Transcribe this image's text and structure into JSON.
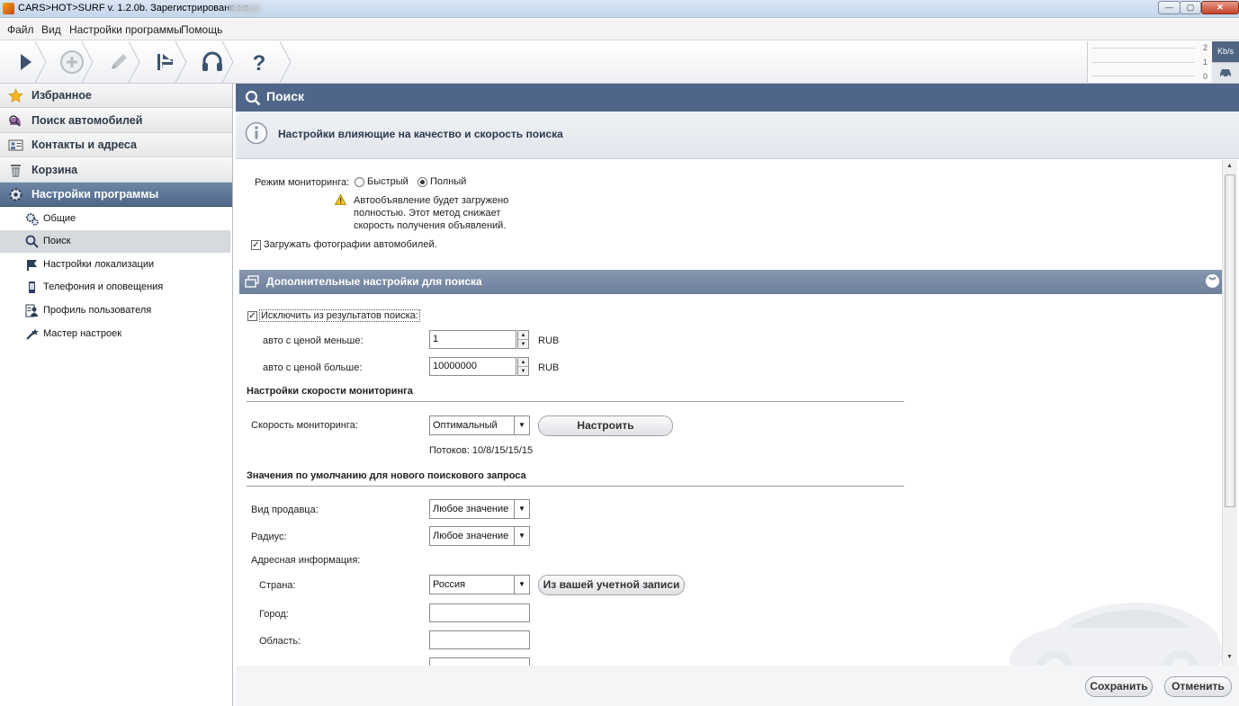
{
  "window": {
    "title": "CARS>HOT>SURF v. 1.2.0b. Зарегистрировано на"
  },
  "menu": [
    "Файл",
    "Вид",
    "Настройки программы",
    "Помощь"
  ],
  "speed_meter": {
    "unit": "Kb/s",
    "ticks": [
      "2",
      "1",
      "0"
    ]
  },
  "sidebar": {
    "sections": [
      {
        "label": "Избранное",
        "icon": "star-icon"
      },
      {
        "label": "Поиск автомобилей",
        "icon": "car-search-icon"
      },
      {
        "label": "Контакты и адреса",
        "icon": "contacts-icon"
      },
      {
        "label": "Корзина",
        "icon": "trash-icon"
      },
      {
        "label": "Настройки программы",
        "icon": "gear-icon"
      }
    ],
    "settings_items": [
      {
        "label": "Общие",
        "icon": "gears-icon"
      },
      {
        "label": "Поиск",
        "icon": "search-icon"
      },
      {
        "label": "Настройки локализации",
        "icon": "flag-icon"
      },
      {
        "label": "Телефония и оповещения",
        "icon": "phone-icon"
      },
      {
        "label": "Профиль пользователя",
        "icon": "user-profile-icon"
      },
      {
        "label": "Мастер настроек",
        "icon": "wand-icon"
      }
    ]
  },
  "main": {
    "title": "Поиск",
    "info": "Настройки влияющие на качество и скорость поиска",
    "monitoring_mode": {
      "label": "Режим мониторинга:",
      "options": [
        "Быстрый",
        "Полный"
      ],
      "selected": "Полный",
      "warning_lines": [
        "Автообъявление будет загружено",
        "полностью. Этот метод снижает",
        "скорость получения объявлений."
      ]
    },
    "load_photos": {
      "label": "Загружать фотографии автомобилей.",
      "checked": true
    },
    "advanced": {
      "title": "Дополнительные настройки для поиска",
      "exclude": {
        "label": "Исключить из результатов поиска:",
        "checked": true
      },
      "price_less": {
        "label": "авто с ценой меньше:",
        "value": "1",
        "unit": "RUB"
      },
      "price_more": {
        "label": "авто с ценой больше:",
        "value": "10000000",
        "unit": "RUB"
      },
      "speed_section": "Настройки скорости мониторинга",
      "speed": {
        "label": "Скорость мониторинга:",
        "value": "Оптимальный",
        "button": "Настроить",
        "threads": "Потоков: 10/8/15/15/15"
      },
      "defaults_section": "Значения по умолчанию для нового поискового запроса",
      "seller_type": {
        "label": "Вид продавца:",
        "value": "Любое значение"
      },
      "radius": {
        "label": "Радиус:",
        "value": "Любое значение"
      },
      "address_label": "Адресная информация:",
      "country": {
        "label": "Страна:",
        "value": "Россия",
        "button": "Из вашей учетной записи"
      },
      "city": {
        "label": "Город:",
        "value": ""
      },
      "region": {
        "label": "Область:",
        "value": ""
      }
    }
  },
  "footer": {
    "save": "Сохранить",
    "cancel": "Отменить"
  },
  "colors": {
    "accent": "#4f6688",
    "section_bar": "#7a8aa5"
  }
}
